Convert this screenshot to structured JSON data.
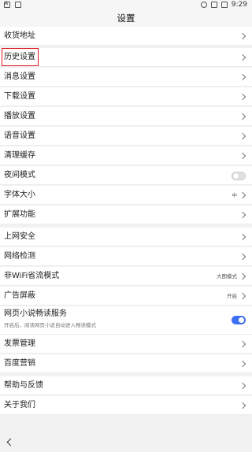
{
  "status_bar": {
    "time": "9:29"
  },
  "header": {
    "title": "设置"
  },
  "sections": {
    "s1": [
      "收货地址"
    ],
    "s2": [
      "历史设置",
      "消息设置",
      "下载设置",
      "播放设置",
      "语音设置",
      "清理缓存",
      "夜间模式",
      "字体大小",
      "扩展功能"
    ],
    "s3": [
      "上网安全",
      "网络检测",
      "非WiFi省流模式",
      "广告屏蔽",
      "网页小说畅读服务",
      "发票管理",
      "百度营销"
    ],
    "s4": [
      "帮助与反馈",
      "关于我们"
    ]
  },
  "values": {
    "font_size": "中",
    "nonwifi_mode": "大图模式",
    "ad_block": "开启"
  },
  "toggles": {
    "night_mode": false,
    "novel_reading": true
  },
  "novel_reading_subtitle": "开启后，阅读网页小说自动进入畅读模式",
  "colors": {
    "accent": "#3b6ff5",
    "highlight_box": "#e0181b"
  }
}
